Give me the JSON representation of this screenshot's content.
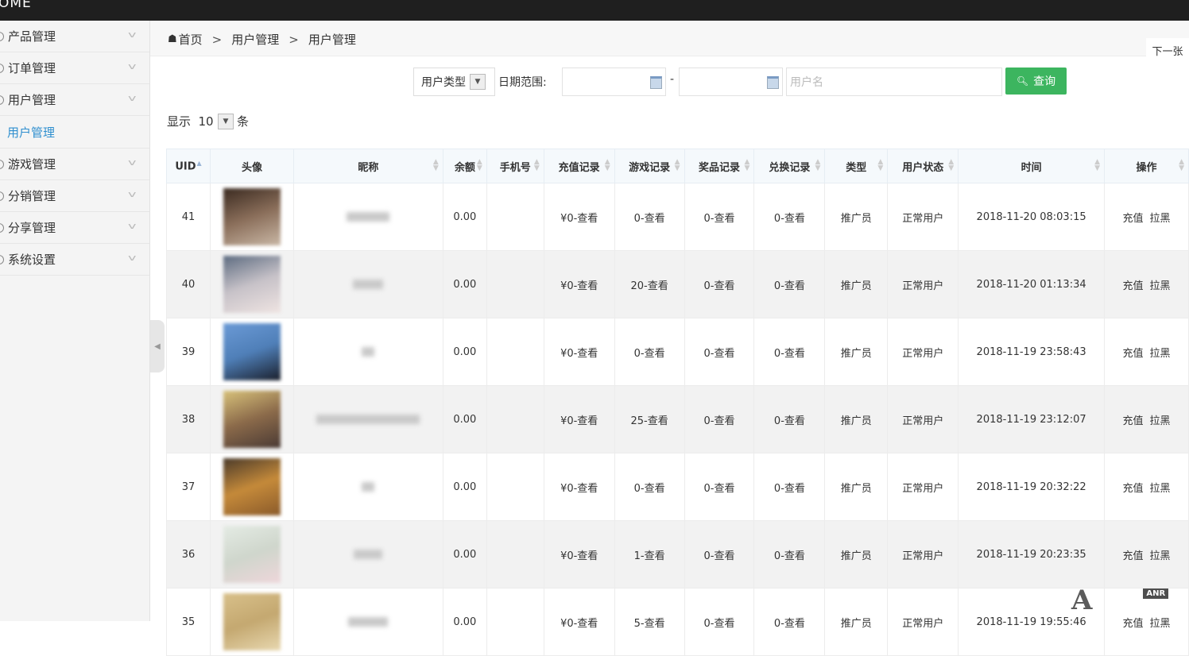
{
  "topbar": {
    "brand": "OME"
  },
  "sidebar": {
    "items": [
      {
        "label": "产品管理"
      },
      {
        "label": "订单管理"
      },
      {
        "label": "用户管理"
      },
      {
        "label": "用户管理",
        "sub": true
      },
      {
        "label": "游戏管理"
      },
      {
        "label": "分销管理"
      },
      {
        "label": "分享管理"
      },
      {
        "label": "系统设置"
      }
    ]
  },
  "breadcrumb": {
    "home": "首页",
    "sep": ">",
    "level1": "用户管理",
    "level2": "用户管理"
  },
  "next_label": "下一张",
  "filters": {
    "user_type": "用户类型",
    "date_label": "日期范围:",
    "date_sep": "-",
    "username_placeholder": "用户名",
    "query_label": "查询"
  },
  "paging": {
    "show": "显示",
    "size": "10",
    "unit": "条"
  },
  "table": {
    "headers": [
      "UID",
      "头像",
      "昵称",
      "余额",
      "手机号",
      "充值记录",
      "游戏记录",
      "奖品记录",
      "兑换记录",
      "类型",
      "用户状态",
      "时间",
      "操作"
    ],
    "rows": [
      {
        "uid": "41",
        "balance": "0.00",
        "recharge": "¥0-查看",
        "game": "0-查看",
        "prize": "0-查看",
        "exchange": "0-查看",
        "type": "推广员",
        "status": "正常用户",
        "time": "2018-11-20 08:03:15",
        "nick_w": 54,
        "colors": [
          "#3a2a20",
          "#8a6e5a",
          "#c9b7a5"
        ]
      },
      {
        "uid": "40",
        "balance": "0.00",
        "recharge": "¥0-查看",
        "game": "20-查看",
        "prize": "0-查看",
        "exchange": "0-查看",
        "type": "推广员",
        "status": "正常用户",
        "time": "2018-11-20 01:13:34",
        "nick_w": 38,
        "colors": [
          "#5c6b80",
          "#c7c2c8",
          "#efe4e2"
        ]
      },
      {
        "uid": "39",
        "balance": "0.00",
        "recharge": "¥0-查看",
        "game": "0-查看",
        "prize": "0-查看",
        "exchange": "0-查看",
        "type": "推广员",
        "status": "正常用户",
        "time": "2018-11-19 23:58:43",
        "nick_w": 16,
        "colors": [
          "#6b9ad6",
          "#4f7fb8",
          "#1a1f2b"
        ]
      },
      {
        "uid": "38",
        "balance": "0.00",
        "recharge": "¥0-查看",
        "game": "25-查看",
        "prize": "0-查看",
        "exchange": "0-查看",
        "type": "推广员",
        "status": "正常用户",
        "time": "2018-11-19 23:12:07",
        "nick_w": 130,
        "colors": [
          "#d8c27a",
          "#8b6a4a",
          "#4a3a34"
        ]
      },
      {
        "uid": "37",
        "balance": "0.00",
        "recharge": "¥0-查看",
        "game": "0-查看",
        "prize": "0-查看",
        "exchange": "0-查看",
        "type": "推广员",
        "status": "正常用户",
        "time": "2018-11-19 20:32:22",
        "nick_w": 16,
        "colors": [
          "#4a3a2a",
          "#c58a3a",
          "#8a5a2a"
        ]
      },
      {
        "uid": "36",
        "balance": "0.00",
        "recharge": "¥0-查看",
        "game": "1-查看",
        "prize": "0-查看",
        "exchange": "0-查看",
        "type": "推广员",
        "status": "正常用户",
        "time": "2018-11-19 20:23:35",
        "nick_w": 36,
        "colors": [
          "#e4ebe4",
          "#cfd6cc",
          "#eed6da"
        ]
      },
      {
        "uid": "35",
        "balance": "0.00",
        "recharge": "¥0-查看",
        "game": "5-查看",
        "prize": "0-查看",
        "exchange": "0-查看",
        "type": "推广员",
        "status": "正常用户",
        "time": "2018-11-19 19:55:46",
        "nick_w": 50,
        "colors": [
          "#d8c08a",
          "#c4a870",
          "#e8d8b0"
        ]
      }
    ],
    "actions": {
      "recharge": "充值",
      "block": "拉黑"
    }
  },
  "watermark": {
    "badge": "ANR"
  }
}
